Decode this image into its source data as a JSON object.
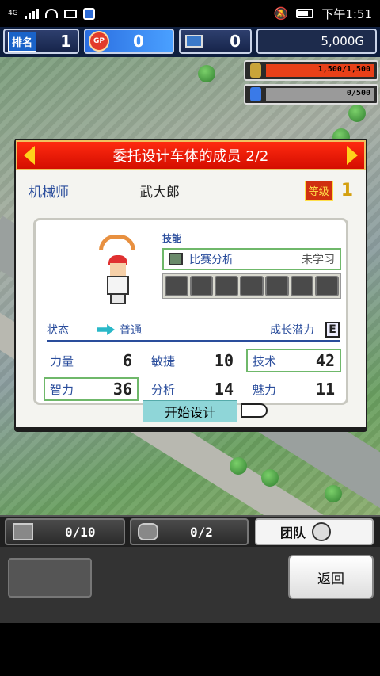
{
  "status_bar": {
    "network": "4G",
    "time": "下午1:51"
  },
  "hud": {
    "rank_label": "排名",
    "rank_value": "1",
    "gp_label": "GP",
    "gp_value": "0",
    "pc_value": "0",
    "money": "5,000G"
  },
  "resources": [
    {
      "name": "fuel",
      "text": "1,500/1,500",
      "fill": 1.0,
      "color": "#e84018"
    },
    {
      "name": "research",
      "text": "0/500",
      "fill": 0.0,
      "color": "#3a8ae8"
    }
  ],
  "dialog": {
    "title": "委托设计车体的成员 2/2",
    "job": "机械师",
    "name": "武大郎",
    "level_label": "等级",
    "level": "1",
    "skills_label": "技能",
    "skill_name": "比赛分析",
    "skill_status": "未学习",
    "status_label": "状态",
    "status_value": "普通",
    "potential_label": "成长潜力",
    "potential_grade": "E",
    "stats": [
      {
        "label": "力量",
        "value": "6",
        "highlight": false
      },
      {
        "label": "敏捷",
        "value": "10",
        "highlight": false
      },
      {
        "label": "技术",
        "value": "42",
        "highlight": true
      },
      {
        "label": "智力",
        "value": "36",
        "highlight": true
      },
      {
        "label": "分析",
        "value": "14",
        "highlight": false
      },
      {
        "label": "魅力",
        "value": "11",
        "highlight": false
      }
    ],
    "start_button": "开始设计"
  },
  "tabs": {
    "parts_count": "0/10",
    "car_count": "0/2",
    "team_label": "团队"
  },
  "bottom": {
    "back_label": "返回"
  }
}
